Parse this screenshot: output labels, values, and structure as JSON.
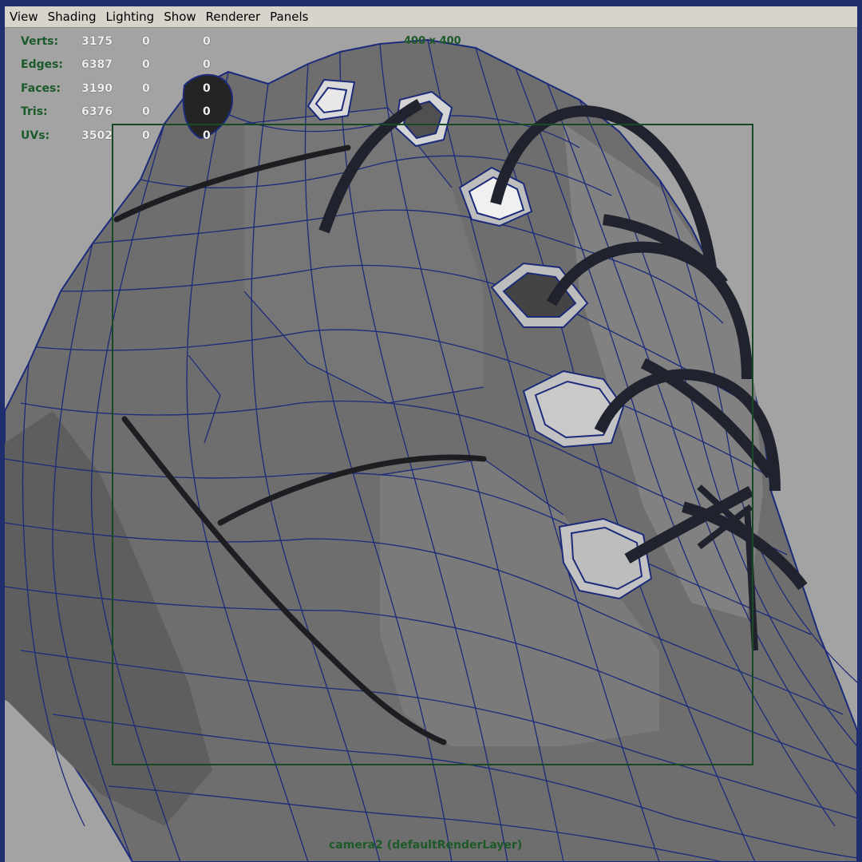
{
  "menu": {
    "items": [
      "View",
      "Shading",
      "Lighting",
      "Show",
      "Renderer",
      "Panels"
    ]
  },
  "hud": {
    "rows": [
      {
        "label": "Verts:",
        "value": "3175",
        "z1": "0",
        "z2": "0"
      },
      {
        "label": "Edges:",
        "value": "6387",
        "z1": "0",
        "z2": "0"
      },
      {
        "label": "Faces:",
        "value": "3190",
        "z1": "0",
        "z2": "0"
      },
      {
        "label": "Tris:",
        "value": "6376",
        "z1": "0",
        "z2": "0"
      },
      {
        "label": "UVs:",
        "value": "3502",
        "z1": "0",
        "z2": "0"
      }
    ]
  },
  "viewport": {
    "resolution_label": "400 x 400",
    "camera_label": "camera2 (defaultRenderLayer)",
    "background_color": "#a3a3a3",
    "mesh_color": "#6f6f6f",
    "wireframe_color": "#1c2a7a",
    "gate_color": "#174a24"
  }
}
